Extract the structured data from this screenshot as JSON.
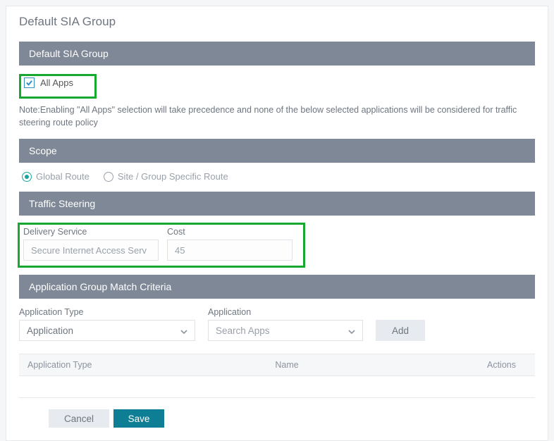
{
  "page": {
    "title": "Default SIA Group"
  },
  "groupHeader": "Default SIA Group",
  "allApps": {
    "label": "All Apps",
    "checked": true
  },
  "note": "Note:Enabling \"All Apps\" selection will take precedence and none of the below selected applications will be considered for traffic steering route policy",
  "scopeHeader": "Scope",
  "scope": {
    "options": [
      {
        "label": "Global Route",
        "selected": true
      },
      {
        "label": "Site / Group Specific Route",
        "selected": false
      }
    ]
  },
  "trafficHeader": "Traffic Steering",
  "traffic": {
    "deliveryServiceLabel": "Delivery Service",
    "deliveryServiceValue": "Secure Internet Access Serv",
    "costLabel": "Cost",
    "costValue": "45"
  },
  "criteriaHeader": "Application Group Match Criteria",
  "criteria": {
    "appTypeLabel": "Application Type",
    "appTypeValue": "Application",
    "appLabel": "Application",
    "appPlaceholder": "Search Apps",
    "addLabel": "Add"
  },
  "table": {
    "cols": [
      "Application Type",
      "Name",
      "Actions"
    ]
  },
  "buttons": {
    "cancel": "Cancel",
    "save": "Save"
  }
}
